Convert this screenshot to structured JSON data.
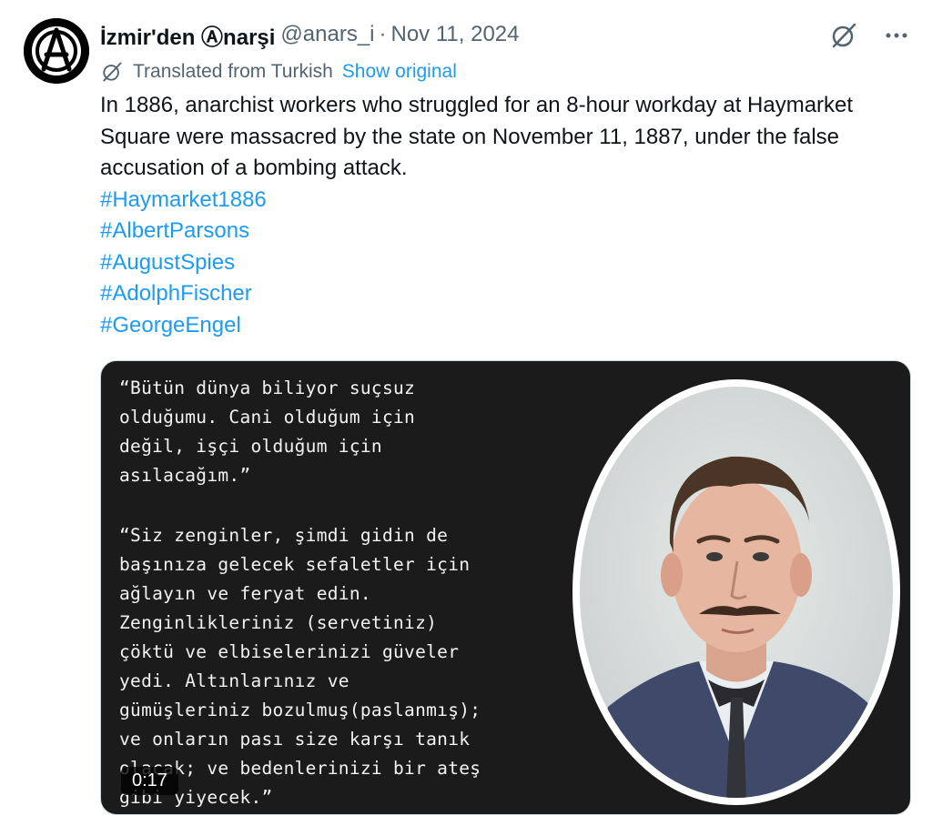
{
  "tweet": {
    "author_name": "İzmir'den Ⓐnarşi",
    "author_handle": "@anars_i",
    "separator": "·",
    "date": "Nov 11, 2024",
    "translated_label": "Translated from Turkish",
    "show_original_label": "Show original",
    "body_text": "In 1886, anarchist workers who struggled for an 8-hour workday at Haymarket Square were massacred by the state on November 11, 1887, under the false accusation of a bombing attack.",
    "hashtags": [
      "#Haymarket1886",
      "#AlbertParsons",
      "#AugustSpies",
      "#AdolphFischer",
      "#GeorgeEngel"
    ]
  },
  "media": {
    "quote_1": "“Bütün dünya biliyor suçsuz\nolduğumu. Cani olduğum için\ndeğil, işçi olduğum için\nasılacağım.”",
    "quote_2": "“Siz zenginler, şimdi gidin de\nbaşınıza gelecek sefaletler için\nağlayın ve feryat edin.\nZenginlikleriniz (servetiniz)\nçöktü ve elbiselerinizi güveler\nyedi. Altınlarınız ve\ngümüşleriniz bozulmuş(paslanmış);\nve onların pası size karşı tanık\nolacak; ve bedenlerinizi bir ateş\ngibi yiyecek.”",
    "video_time": "0:17"
  },
  "icons": {
    "avatar": "anarchy-logo",
    "grok": "grok-icon",
    "more": "more-icon",
    "translate": "translate-icon"
  },
  "colors": {
    "link": "#1d9bf0",
    "secondary_text": "#536471",
    "media_background": "#1b1b1b"
  }
}
